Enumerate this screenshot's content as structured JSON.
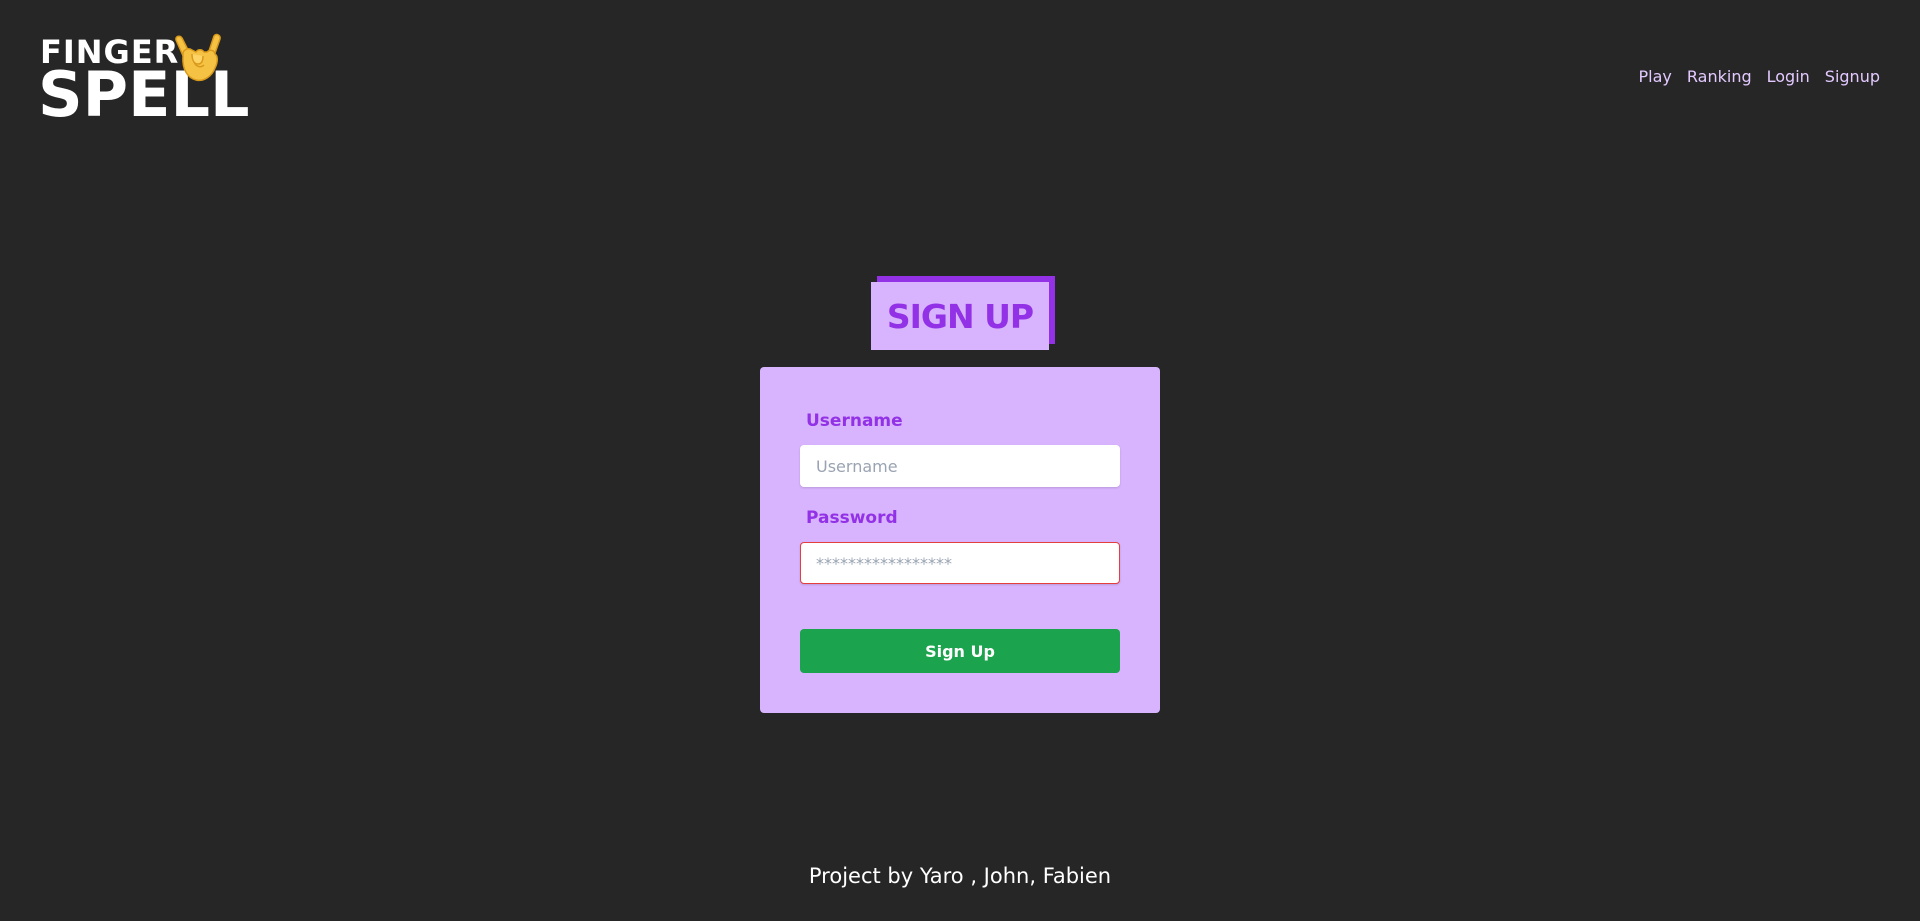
{
  "logo": {
    "line1": "FINGER",
    "line2": "SPELL",
    "icon": "rock-hand-icon",
    "icon_color": "#f6c244"
  },
  "nav": {
    "items": [
      {
        "label": "Play"
      },
      {
        "label": "Ranking"
      },
      {
        "label": "Login"
      },
      {
        "label": "Signup"
      }
    ]
  },
  "page": {
    "title": "SIGN UP"
  },
  "form": {
    "username_label": "Username",
    "username_placeholder": "Username",
    "username_value": "",
    "password_label": "Password",
    "password_placeholder": "*****************",
    "password_value": "",
    "submit_label": "Sign Up"
  },
  "footer": {
    "text": "Project by Yaro , John, Fabien"
  },
  "colors": {
    "background": "#262626",
    "accent_purple": "#9231e6",
    "card_lavender": "#d8b4fe",
    "nav_text": "#e3c9ff",
    "button_green": "#1ca34d",
    "error_border": "#e53e3e"
  }
}
